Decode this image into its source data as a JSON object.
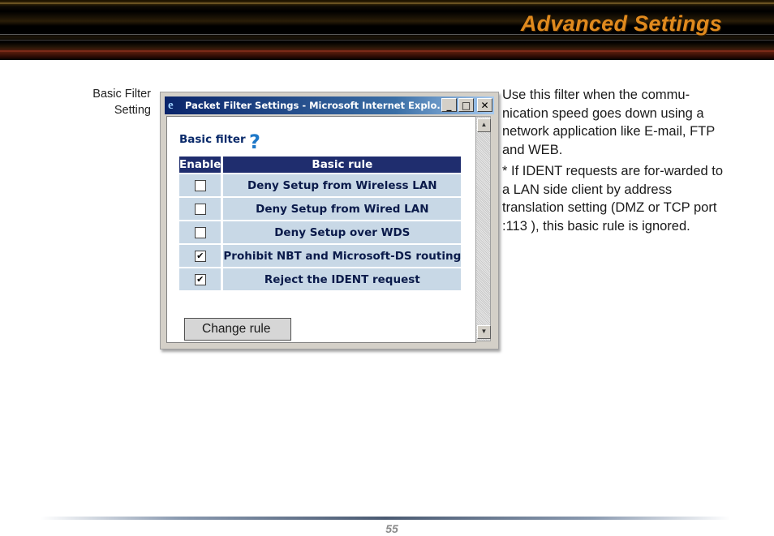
{
  "header": {
    "title": "Advanced Settings"
  },
  "caption": {
    "line1": "Basic Filter",
    "line2": "Setting"
  },
  "window": {
    "title": "Packet Filter Settings - Microsoft Internet Explo...",
    "icon": "ie-logo-icon",
    "controls": {
      "minimize": "_",
      "maximize": "□",
      "close": "✕"
    }
  },
  "basic_filter": {
    "heading": "Basic filter",
    "help_symbol": "?",
    "columns": {
      "enable": "Enable",
      "rule": "Basic rule"
    },
    "rows": [
      {
        "rule": "Deny Setup from Wireless LAN",
        "enabled": false,
        "mark": ""
      },
      {
        "rule": "Deny Setup from Wired LAN",
        "enabled": false,
        "mark": ""
      },
      {
        "rule": "Deny Setup over WDS",
        "enabled": false,
        "mark": ""
      },
      {
        "rule": "Prohibit NBT and Microsoft-DS routing",
        "enabled": true,
        "mark": "✔"
      },
      {
        "rule": "Reject the IDENT request",
        "enabled": true,
        "mark": "✔"
      }
    ],
    "button": "Change rule"
  },
  "description": {
    "para1": "Use this filter when the commu-nication speed goes down using a network application like E-mail, FTP and WEB.",
    "para2": "* If IDENT requests are for-warded to a LAN side client by address translation setting (DMZ or TCP port :113 ), this basic rule is ignored."
  },
  "footer": {
    "page_number": "55"
  }
}
